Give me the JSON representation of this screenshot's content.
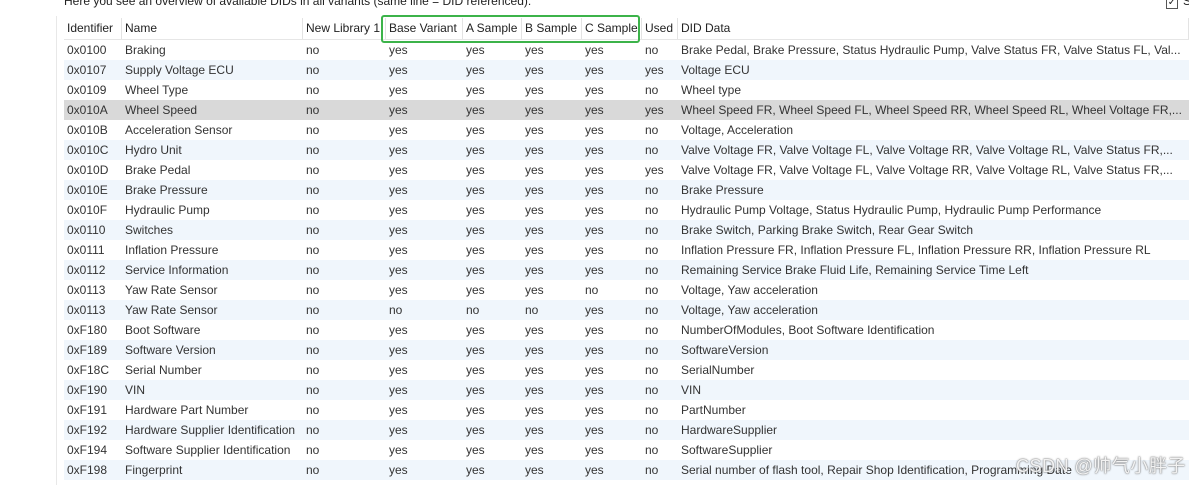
{
  "hint": "Here you see an overview of available DIDs in all variants (same line = DID referenced):",
  "top_checkbox": {
    "checked_glyph": "✓",
    "label": "S"
  },
  "columns": [
    "Identifier",
    "Name",
    "New Library 1",
    "Base Variant",
    "A Sample",
    "B Sample",
    "C Sample",
    "Used",
    "DID Data"
  ],
  "selected_row": 3,
  "rows": [
    [
      "0x0100",
      "Braking",
      "no",
      "yes",
      "yes",
      "yes",
      "yes",
      "no",
      "Brake Pedal, Brake Pressure, Status Hydraulic Pump, Valve Status FR, Valve Status FL, Val..."
    ],
    [
      "0x0107",
      "Supply Voltage ECU",
      "no",
      "yes",
      "yes",
      "yes",
      "yes",
      "yes",
      "Voltage ECU"
    ],
    [
      "0x0109",
      "Wheel Type",
      "no",
      "yes",
      "yes",
      "yes",
      "yes",
      "no",
      "Wheel type"
    ],
    [
      "0x010A",
      "Wheel Speed",
      "no",
      "yes",
      "yes",
      "yes",
      "yes",
      "yes",
      "Wheel Speed FR, Wheel Speed FL, Wheel Speed RR, Wheel Speed RL, Wheel Voltage FR,..."
    ],
    [
      "0x010B",
      "Acceleration Sensor",
      "no",
      "yes",
      "yes",
      "yes",
      "yes",
      "no",
      "Voltage, Acceleration"
    ],
    [
      "0x010C",
      "Hydro Unit",
      "no",
      "yes",
      "yes",
      "yes",
      "yes",
      "no",
      "Valve Voltage FR, Valve Voltage FL, Valve Voltage RR, Valve Voltage RL, Valve Status FR,..."
    ],
    [
      "0x010D",
      "Brake Pedal",
      "no",
      "yes",
      "yes",
      "yes",
      "yes",
      "yes",
      "Valve Voltage FR, Valve Voltage FL, Valve Voltage RR, Valve Voltage RL, Valve Status FR,..."
    ],
    [
      "0x010E",
      "Brake Pressure",
      "no",
      "yes",
      "yes",
      "yes",
      "yes",
      "no",
      "Brake Pressure"
    ],
    [
      "0x010F",
      "Hydraulic Pump",
      "no",
      "yes",
      "yes",
      "yes",
      "yes",
      "no",
      "Hydraulic Pump Voltage, Status Hydraulic Pump, Hydraulic Pump Performance"
    ],
    [
      "0x0110",
      "Switches",
      "no",
      "yes",
      "yes",
      "yes",
      "yes",
      "no",
      "Brake Switch, Parking Brake Switch, Rear Gear Switch"
    ],
    [
      "0x0111",
      "Inflation Pressure",
      "no",
      "yes",
      "yes",
      "yes",
      "yes",
      "no",
      "Inflation Pressure FR, Inflation Pressure FL, Inflation Pressure RR, Inflation Pressure RL"
    ],
    [
      "0x0112",
      "Service Information",
      "no",
      "yes",
      "yes",
      "yes",
      "yes",
      "no",
      "Remaining Service Brake Fluid Life, Remaining Service Time Left"
    ],
    [
      "0x0113",
      "Yaw Rate Sensor",
      "no",
      "yes",
      "yes",
      "yes",
      "no",
      "no",
      "Voltage, Yaw acceleration"
    ],
    [
      "0x0113",
      "Yaw Rate Sensor",
      "no",
      "no",
      "no",
      "no",
      "yes",
      "no",
      "Voltage, Yaw acceleration"
    ],
    [
      "0xF180",
      "Boot Software",
      "no",
      "yes",
      "yes",
      "yes",
      "yes",
      "no",
      "NumberOfModules, Boot Software Identification"
    ],
    [
      "0xF189",
      "Software Version",
      "no",
      "yes",
      "yes",
      "yes",
      "yes",
      "no",
      "SoftwareVersion"
    ],
    [
      "0xF18C",
      "Serial Number",
      "no",
      "yes",
      "yes",
      "yes",
      "yes",
      "no",
      "SerialNumber"
    ],
    [
      "0xF190",
      "VIN",
      "no",
      "yes",
      "yes",
      "yes",
      "yes",
      "no",
      "VIN"
    ],
    [
      "0xF191",
      "Hardware Part Number",
      "no",
      "yes",
      "yes",
      "yes",
      "yes",
      "no",
      "PartNumber"
    ],
    [
      "0xF192",
      "Hardware Supplier Identification",
      "no",
      "yes",
      "yes",
      "yes",
      "yes",
      "no",
      "HardwareSupplier"
    ],
    [
      "0xF194",
      "Software Supplier Identification",
      "no",
      "yes",
      "yes",
      "yes",
      "yes",
      "no",
      "SoftwareSupplier"
    ],
    [
      "0xF198",
      "Fingerprint",
      "no",
      "yes",
      "yes",
      "yes",
      "yes",
      "no",
      "Serial number of flash tool, Repair Shop Identification, Programming Date"
    ]
  ],
  "watermark": "CSDN @帅气小胖子",
  "colors": {
    "highlight_box": "#3cb34a",
    "alt_row": "#f0f6fc",
    "selected_row": "#d9d9d9"
  }
}
